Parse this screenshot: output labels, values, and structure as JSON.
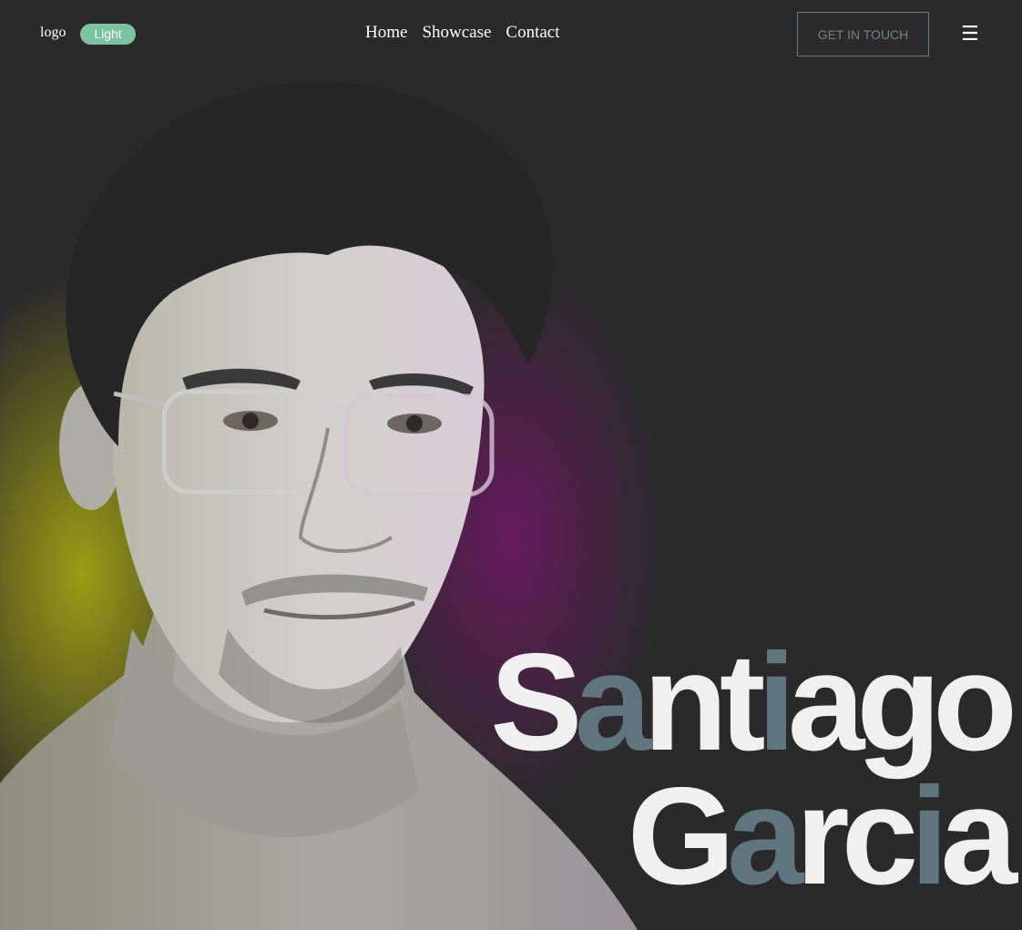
{
  "nav": {
    "logo": "logo",
    "theme_toggle": "Light",
    "links": [
      "Home",
      "Showcase",
      "Contact"
    ],
    "cta": "GET IN TOUCH",
    "menu_icon": "☰"
  },
  "hero": {
    "first_name_parts": [
      "S",
      "a",
      "nt",
      "i",
      "ago"
    ],
    "last_name_parts": [
      "G",
      "a",
      "rc",
      "i",
      "a"
    ],
    "portrait_icon": "portrait-photo"
  },
  "colors": {
    "background": "#2a2a2b",
    "toggle": "#7cc39f",
    "name_text": "#f0f0f0",
    "name_accent": "#5f7580",
    "glow_yellow": "#a2a214",
    "glow_magenta": "#6a1a5f"
  }
}
